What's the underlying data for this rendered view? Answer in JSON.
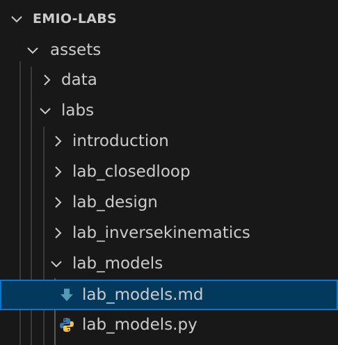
{
  "explorer": {
    "root_label": "EMIO-LABS",
    "items": [
      {
        "label": "assets"
      },
      {
        "label": "data"
      },
      {
        "label": "labs"
      },
      {
        "label": "introduction"
      },
      {
        "label": "lab_closedloop"
      },
      {
        "label": "lab_design"
      },
      {
        "label": "lab_inversekinematics"
      },
      {
        "label": "lab_models"
      },
      {
        "label": "lab_models.md",
        "icon": "markdown-download-icon"
      },
      {
        "label": "lab_models.py",
        "icon": "python-icon"
      }
    ]
  },
  "colors": {
    "background": "#181818",
    "selection_bg": "#04395e",
    "selection_border": "#0078d4",
    "text": "#cccccc",
    "markdown_icon": "#519aba",
    "python_icon_blue": "#3b77a8",
    "python_icon_yellow": "#f6c343"
  }
}
